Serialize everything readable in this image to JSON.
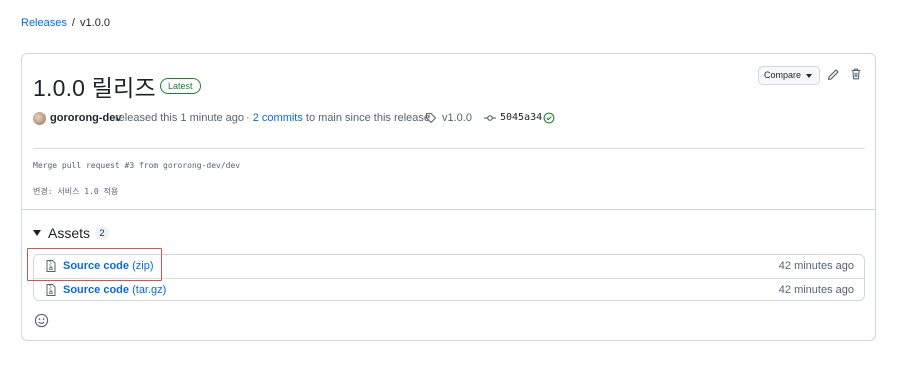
{
  "breadcrumb": {
    "parent": "Releases",
    "separator": "/",
    "current": "v1.0.0"
  },
  "release": {
    "title": "1.0.0 릴리즈",
    "badge": "Latest",
    "author": "gororong-dev",
    "released_text": "released this 1 minute ago",
    "commits_link": "2 commits",
    "commits_suffix": "to main since this release",
    "commits_prefix": "·",
    "tag": "v1.0.0",
    "commit_sha": "5045a34",
    "body_line1": "Merge pull request #3 from gororong-dev/dev",
    "body_line2": "변경: 서비스 1.0 적용"
  },
  "actions": {
    "compare_label": "Compare"
  },
  "assets": {
    "heading": "Assets",
    "count": "2",
    "items": [
      {
        "name": "Source code",
        "ext": "(zip)",
        "time": "42 minutes ago"
      },
      {
        "name": "Source code",
        "ext": "(tar.gz)",
        "time": "42 minutes ago"
      }
    ]
  },
  "icons": {
    "edit": "pencil-icon",
    "delete": "trash-icon",
    "tag": "tag-icon",
    "commit": "git-commit-icon",
    "verified": "check-circle-icon",
    "archive": "file-zip-icon",
    "reaction": "smiley-icon"
  },
  "colors": {
    "link": "#0969da",
    "latest": "#1a7f37",
    "highlight": "#e0504a"
  }
}
